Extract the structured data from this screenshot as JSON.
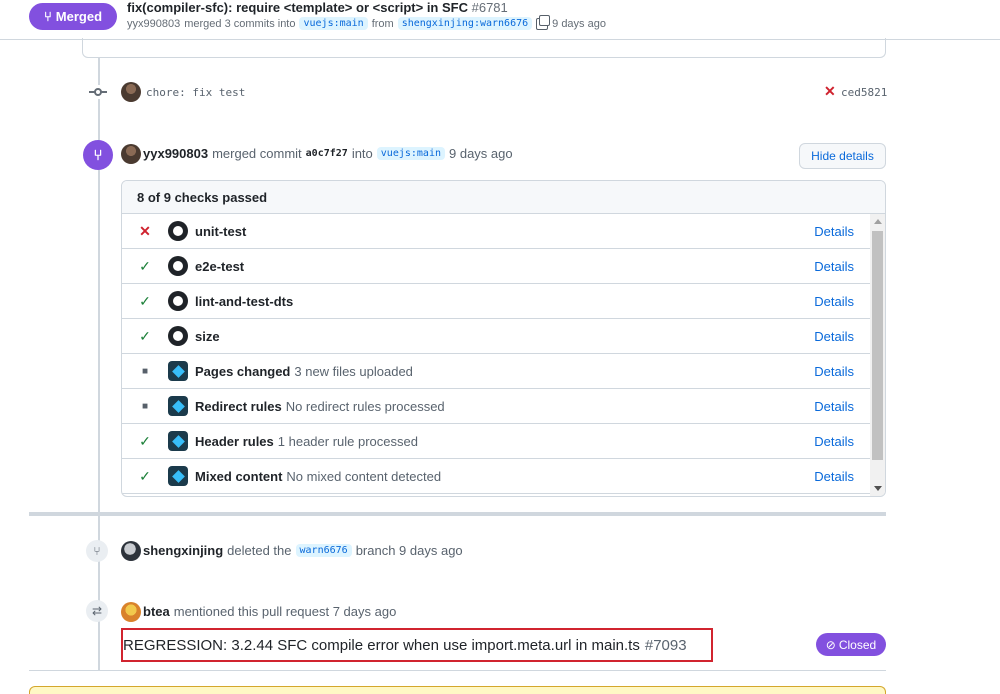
{
  "header": {
    "status_badge": "Merged",
    "status_icon": "git-merge-icon",
    "title": "fix(compiler-sfc): require <template> or <script> in SFC",
    "number": "#6781",
    "author": "yyx990803",
    "merged_text": "merged 3 commits into",
    "base_branch": "vuejs:main",
    "from_text": "from",
    "head_branch": "shengxinjing:warn6676",
    "time": "9 days ago"
  },
  "commit": {
    "message": "chore: fix test",
    "sha": "ced5821",
    "status": "failed"
  },
  "merge_event": {
    "author": "yyx990803",
    "text": "merged commit",
    "sha": "a0c7f27",
    "into_text": "into",
    "branch": "vuejs:main",
    "time": "9 days ago",
    "hide_button": "Hide details"
  },
  "checks": {
    "summary": "8 of 9 checks passed",
    "details_label": "Details",
    "items": [
      {
        "status": "fail",
        "logo": "github-icon",
        "name": "unit-test",
        "desc": ""
      },
      {
        "status": "pass",
        "logo": "github-icon",
        "name": "e2e-test",
        "desc": ""
      },
      {
        "status": "pass",
        "logo": "github-icon",
        "name": "lint-and-test-dts",
        "desc": ""
      },
      {
        "status": "pass",
        "logo": "github-icon",
        "name": "size",
        "desc": ""
      },
      {
        "status": "neutral",
        "logo": "netlify-icon",
        "name": "Pages changed",
        "desc": "3 new files uploaded"
      },
      {
        "status": "neutral",
        "logo": "netlify-icon",
        "name": "Redirect rules",
        "desc": "No redirect rules processed"
      },
      {
        "status": "pass",
        "logo": "netlify-icon",
        "name": "Header rules",
        "desc": "1 header rule processed"
      },
      {
        "status": "pass",
        "logo": "netlify-icon",
        "name": "Mixed content",
        "desc": "No mixed content detected"
      }
    ]
  },
  "delete_event": {
    "author": "shengxinjing",
    "text": "deleted the",
    "branch": "warn6676",
    "suffix": "branch 9 days ago"
  },
  "mention_event": {
    "author": "btea",
    "text": "mentioned this pull request 7 days ago",
    "issue_title": "REGRESSION: 3.2.44 SFC compile error when use import.meta.url in main.ts",
    "issue_number": "#7093",
    "issue_status": "Closed"
  },
  "colors": {
    "merged_purple": "#8250df",
    "fail_red": "#cf222e",
    "pass_green": "#1a7f37",
    "link_blue": "#0969da",
    "highlight_red": "#d1242f"
  }
}
